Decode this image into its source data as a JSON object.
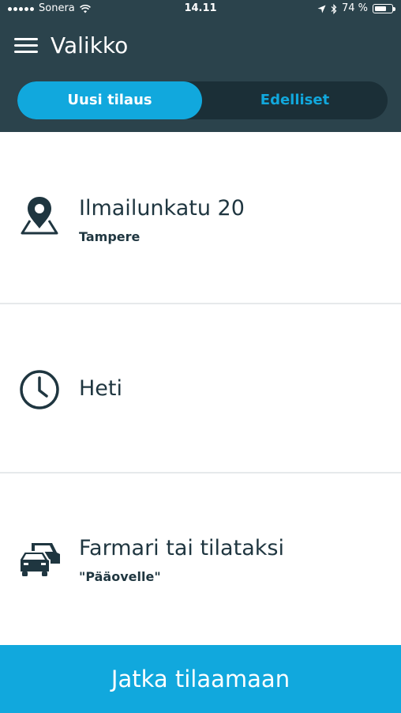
{
  "status_bar": {
    "carrier": "Sonera",
    "time": "14.11",
    "battery": "74 %",
    "battery_level": 0.74
  },
  "app_bar": {
    "title": "Valikko",
    "menu_icon": "hamburger-menu-icon"
  },
  "tabs": [
    {
      "label": "Uusi tilaus",
      "active": true
    },
    {
      "label": "Edelliset",
      "active": false
    }
  ],
  "rows": {
    "address": {
      "title": "Ilmailunkatu 20",
      "subtitle": "Tampere",
      "icon": "map-pin-icon"
    },
    "time": {
      "title": "Heti",
      "icon": "clock-icon"
    },
    "vehicle": {
      "title": "Farmari tai tilataksi",
      "subtitle": "\"Pääovelle\"",
      "icon": "cars-icon"
    }
  },
  "footer": {
    "continue_label": "Jatka tilaamaan"
  },
  "colors": {
    "header": "#2b434c",
    "accent": "#11a8dd",
    "text": "#1f3640"
  }
}
